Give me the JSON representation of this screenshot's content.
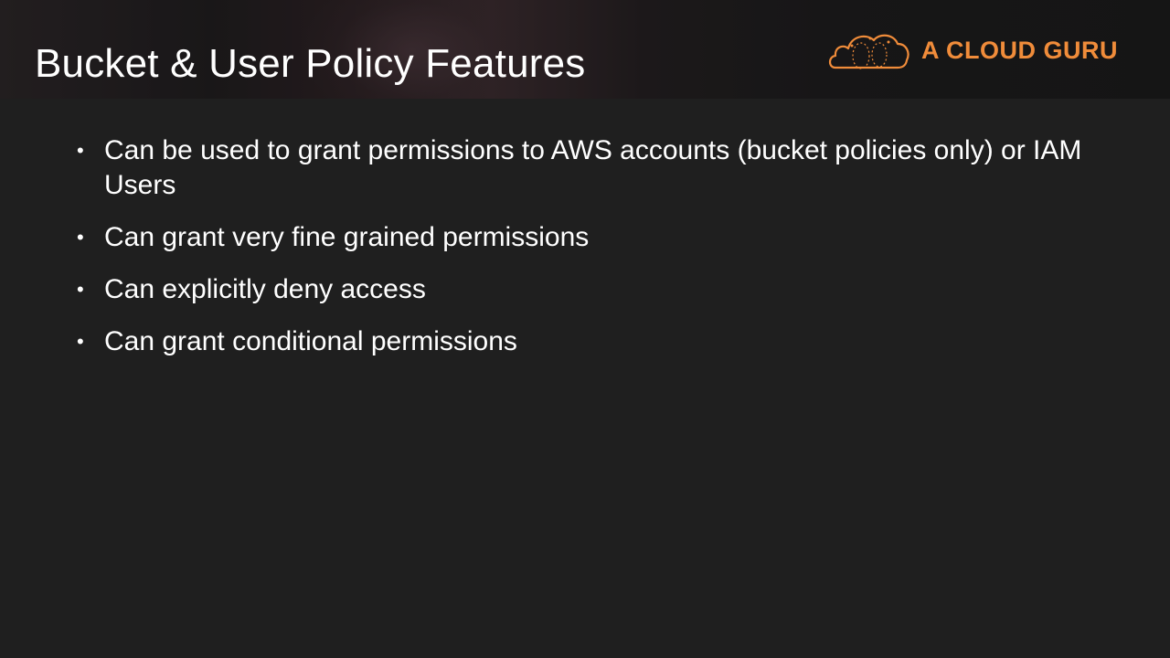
{
  "header": {
    "title": "Bucket & User Policy Features"
  },
  "logo": {
    "text": "A CLOUD GURU",
    "icon": "cloud-logo-icon",
    "color": "#f08c3a"
  },
  "bullets": [
    {
      "text": "Can be used to grant permissions to AWS accounts (bucket policies only) or IAM Users"
    },
    {
      "text": "Can grant very fine grained permissions"
    },
    {
      "text": "Can explicitly deny access"
    },
    {
      "text": "Can grant conditional permissions"
    }
  ],
  "bullet_symbol": "•"
}
